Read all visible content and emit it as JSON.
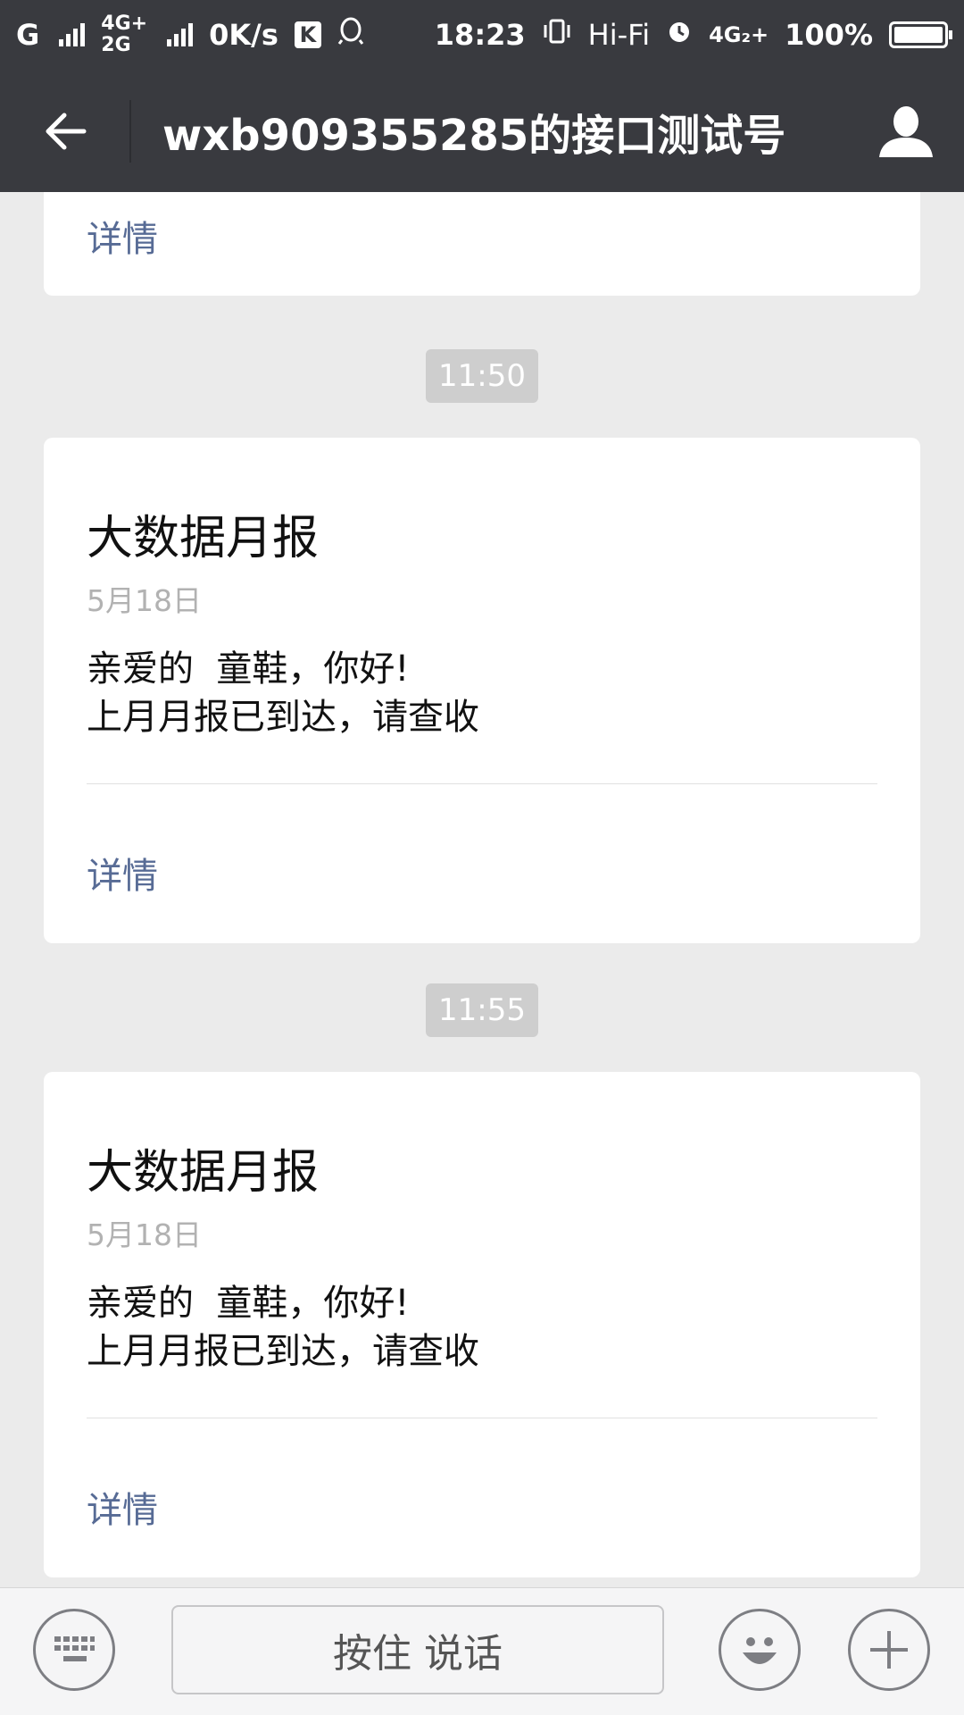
{
  "status_bar": {
    "carrier": "G",
    "net_top": "4G+",
    "net_bottom": "2G",
    "speed": "0K/s",
    "k_icon": "K",
    "time": "18:23",
    "hifi": "Hi-Fi",
    "net2": "4G₂+",
    "battery": "100%"
  },
  "header": {
    "title": "wxb909355285的接口测试号",
    "back_icon": "arrow-left-icon",
    "profile_icon": "person-icon"
  },
  "messages": {
    "partial": {
      "detail": "详情"
    },
    "time1": "11:50",
    "card1": {
      "title": "大数据月报",
      "date": "5月18日",
      "line1": "亲爱的  童鞋，你好!",
      "line2": "上月月报已到达，请查收",
      "detail": "详情"
    },
    "time2": "11:55",
    "card2": {
      "title": "大数据月报",
      "date": "5月18日",
      "line1": "亲爱的  童鞋，你好!",
      "line2": "上月月报已到达，请查收",
      "detail": "详情"
    }
  },
  "bottom_bar": {
    "keyboard_icon": "keyboard-icon",
    "hold_to_talk": "按住 说话",
    "emoji_icon": "smiley-icon",
    "plus_icon": "plus-icon"
  },
  "colors": {
    "header_bg": "#393a3f",
    "page_bg": "#ebebeb",
    "link": "#576b95",
    "time_pill": "#cecece"
  }
}
